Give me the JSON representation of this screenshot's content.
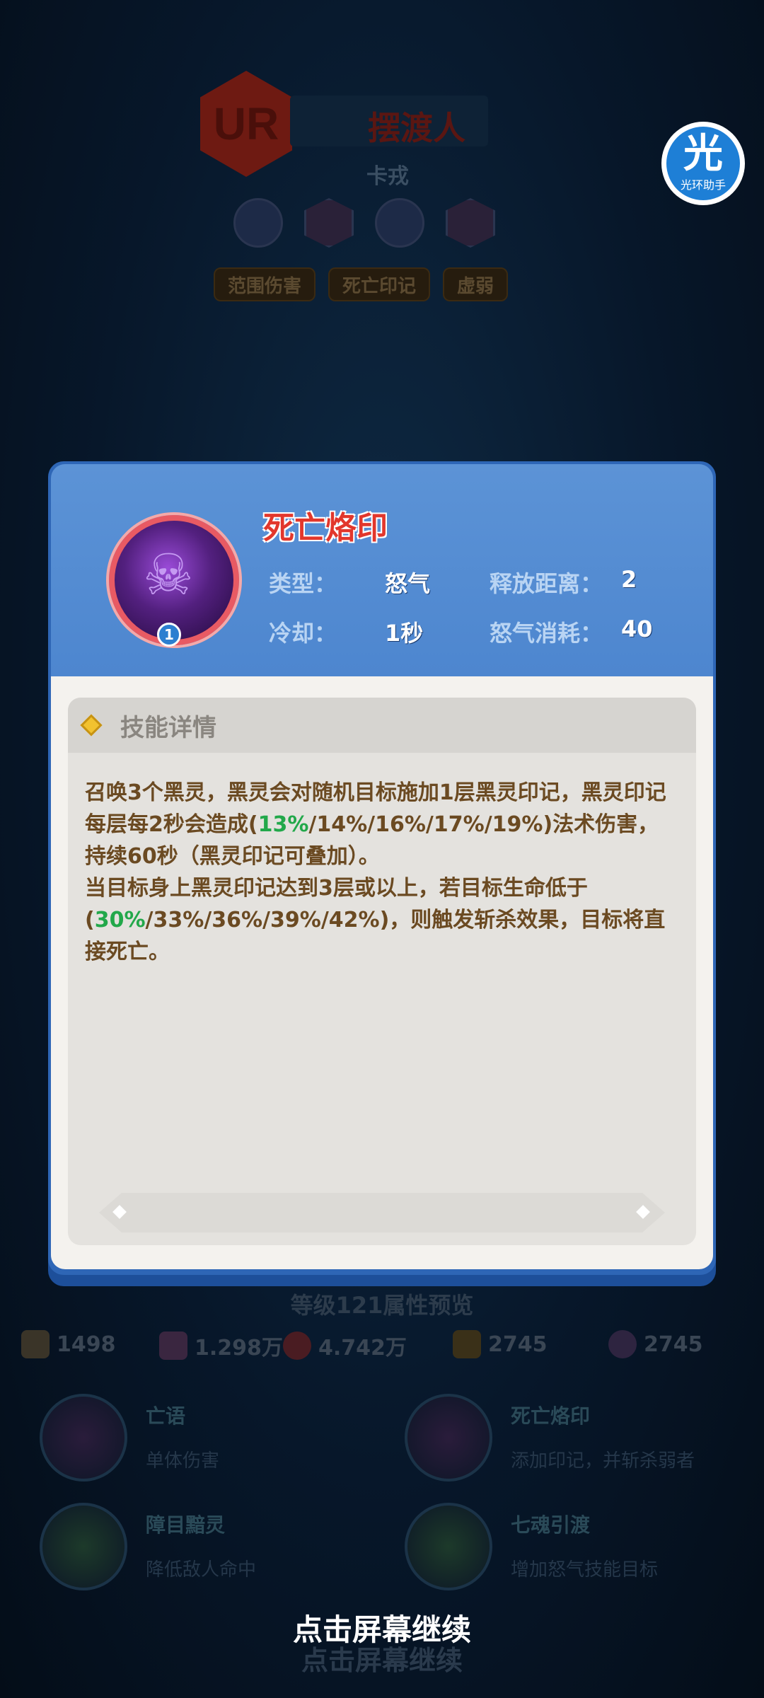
{
  "hero": {
    "rarity": "UR",
    "name": "摆渡人",
    "subtitle": "卡戎",
    "tags": [
      "范围伤害",
      "死亡印记",
      "虚弱"
    ]
  },
  "helper": {
    "glyph": "光",
    "label": "光环助手"
  },
  "skill": {
    "name": "死亡烙印",
    "level": "1",
    "type_label": "类型：",
    "type_value": "怒气",
    "range_label": "释放距离：",
    "range_value": "2",
    "cooldown_label": "冷却：",
    "cooldown_value": "1秒",
    "rage_label": "怒气消耗：",
    "rage_value": "40"
  },
  "detail": {
    "title": "技能详情",
    "p1_a": "召唤3个黑灵，黑灵会对随机目标施加1层黑灵印记，黑灵印记每层每2秒会造成(",
    "p1_hl": "13%",
    "p1_b": "/14%/16%/17%/19%)法术伤害，持续60秒（黑灵印记可叠加）。",
    "p2_a": "当目标身上黑灵印记达到3层或以上，若目标生命低于(",
    "p2_hl": "30%",
    "p2_b": "/33%/36%/39%/42%)，则触发斩杀效果，目标将直接死亡。"
  },
  "preview": {
    "title": "等级121属性预览",
    "stats": [
      "1498",
      "1.298万",
      "4.742万",
      "2745",
      "2745"
    ]
  },
  "skills_list": [
    {
      "name": "亡语",
      "desc": "单体伤害"
    },
    {
      "name": "死亡烙印",
      "desc": "添加印记，并斩杀弱者"
    },
    {
      "name": "障目黯灵",
      "desc": "降低敌人命中"
    },
    {
      "name": "七魂引渡",
      "desc": "增加怒气技能目标"
    }
  ],
  "continue_text": "点击屏幕继续",
  "colors": {
    "accent_green": "#22a84a",
    "skill_name_red": "#e2372c",
    "modal_blue": "#4d86cf"
  }
}
